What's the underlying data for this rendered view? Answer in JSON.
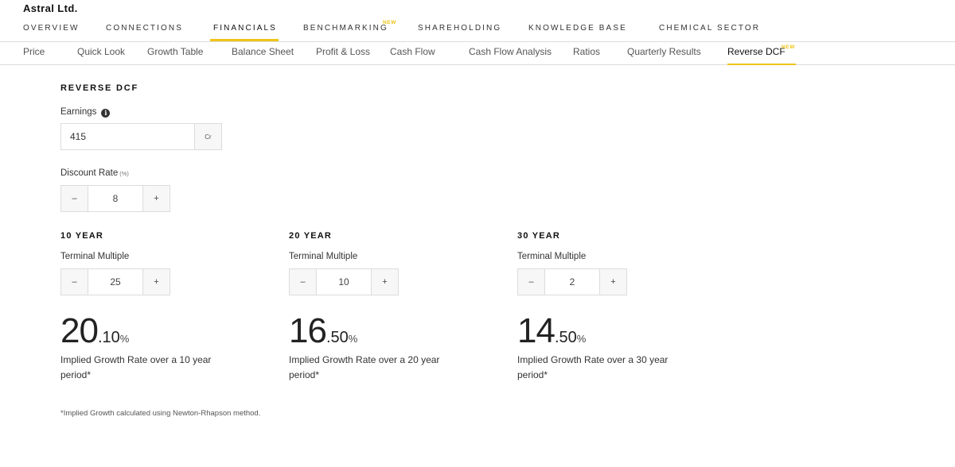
{
  "company": "Astral Ltd.",
  "main_nav": [
    "OVERVIEW",
    "CONNECTIONS",
    "FINANCIALS",
    "BENCHMARKING",
    "SHAREHOLDING",
    "KNOWLEDGE BASE",
    "CHEMICAL SECTOR"
  ],
  "main_nav_active": "FINANCIALS",
  "new_badge": "NEW",
  "sub_nav": [
    "Price",
    "Quick Look",
    "Growth Table",
    "Balance Sheet",
    "Profit & Loss",
    "Cash Flow",
    "Cash Flow Analysis",
    "Ratios",
    "Quarterly Results",
    "Reverse DCF"
  ],
  "sub_nav_active": "Reverse DCF",
  "section_title": "REVERSE DCF",
  "earnings": {
    "label": "Earnings",
    "info_icon": "info-icon",
    "value": "415",
    "unit": "Cr"
  },
  "discount": {
    "label": "Discount Rate",
    "unit": "(%)",
    "value": "8"
  },
  "stepper": {
    "minus": "–",
    "plus": "+"
  },
  "terminal_label": "Terminal Multiple",
  "columns": [
    {
      "title": "10 YEAR",
      "multiple": "25",
      "growth_int": "20",
      "growth_dec": ".10",
      "growth_pct": "%",
      "desc": "Implied Growth Rate over a 10 year period*"
    },
    {
      "title": "20 YEAR",
      "multiple": "10",
      "growth_int": "16",
      "growth_dec": ".50",
      "growth_pct": "%",
      "desc": "Implied Growth Rate over a 20 year period*"
    },
    {
      "title": "30 YEAR",
      "multiple": "2",
      "growth_int": "14",
      "growth_dec": ".50",
      "growth_pct": "%",
      "desc": "Implied Growth Rate over a 30 year period*"
    }
  ],
  "footnote": "*Implied Growth calculated using Newton-Rhapson method.",
  "colors": {
    "accent": "#f0c419",
    "border": "#dcdcdc",
    "button_bg": "#f7f7f7"
  }
}
